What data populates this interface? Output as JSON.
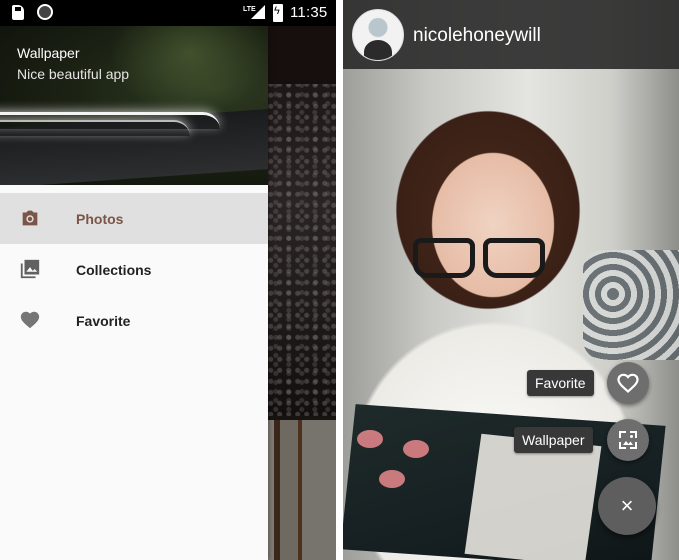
{
  "left_screen": {
    "status_bar": {
      "network_label": "LTE",
      "time": "11:35"
    },
    "drawer": {
      "header_title": "Wallpaper",
      "header_subtitle": "Nice beautiful app",
      "items": [
        {
          "label": "Photos",
          "icon": "camera-icon",
          "active": true
        },
        {
          "label": "Collections",
          "icon": "collections-icon",
          "active": false
        },
        {
          "label": "Favorite",
          "icon": "heart-icon",
          "active": false
        }
      ]
    }
  },
  "right_screen": {
    "username": "nicolehoneywill",
    "fab_menu": {
      "favorite_label": "Favorite",
      "wallpaper_label": "Wallpaper",
      "close_symbol": "×"
    }
  },
  "colors": {
    "accent_active": "#7a5548",
    "drawer_bg": "#fafafa",
    "active_item_bg": "#e0e0e0",
    "fab_bg": "#5e5e5e"
  }
}
